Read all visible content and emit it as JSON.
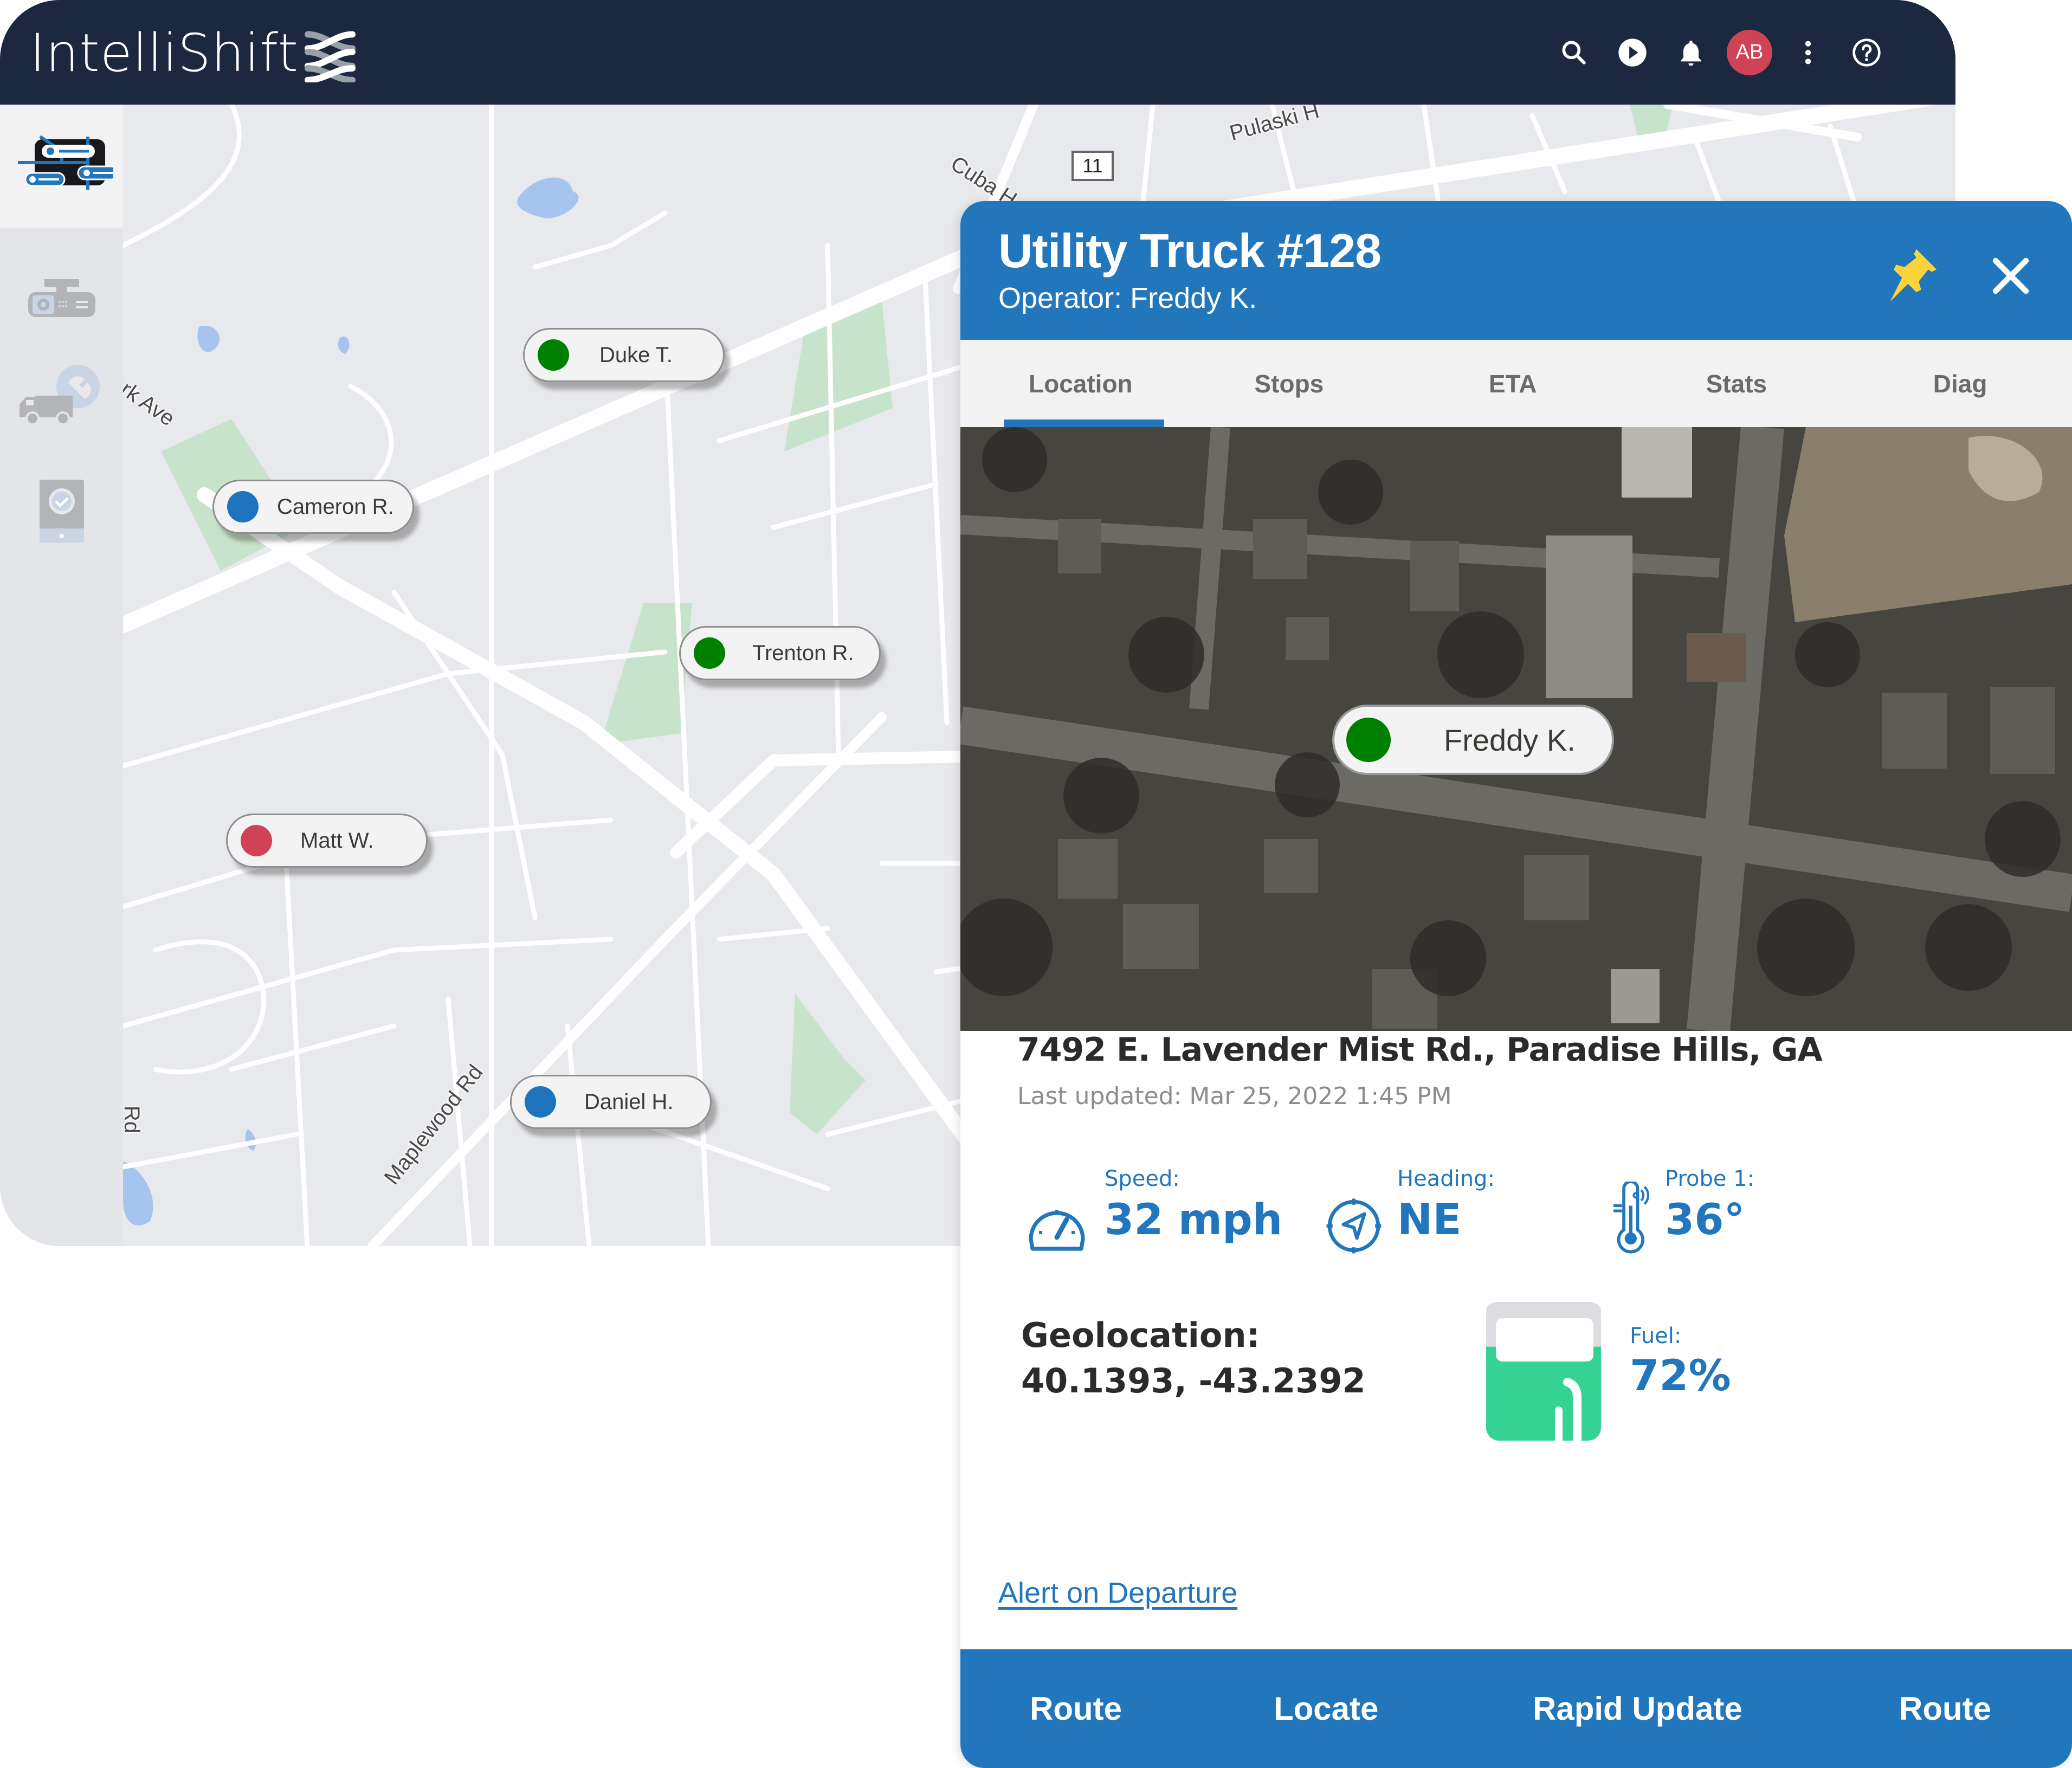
{
  "app": {
    "brand": "IntelliShift",
    "colors": {
      "header_bg": "#1c2740",
      "accent_blue": "#2176bc",
      "status_green": "#008000",
      "status_blue": "#1e73be",
      "status_red": "#d04356",
      "fuel_green": "#34d394"
    }
  },
  "header": {
    "actions": [
      {
        "icon": "search-icon",
        "label": "Search"
      },
      {
        "icon": "play-circle-icon",
        "label": "Play"
      },
      {
        "icon": "bell-icon",
        "label": "Notifications"
      },
      {
        "icon": "avatar",
        "label": "AB"
      },
      {
        "icon": "more-vertical-icon",
        "label": "More"
      },
      {
        "icon": "help-icon",
        "label": "Help"
      }
    ],
    "avatar_initials": "AB"
  },
  "sidebar": {
    "items": [
      {
        "icon": "live-map-icon",
        "label": "Live Map",
        "active": true
      },
      {
        "icon": "dashcam-icon",
        "label": "Dashcam",
        "active": false
      },
      {
        "icon": "truck-maintenance-icon",
        "label": "Maintenance",
        "active": false
      },
      {
        "icon": "mobile-inspection-icon",
        "label": "Inspections",
        "active": false
      }
    ]
  },
  "map": {
    "street_labels": [
      "Pulaski H",
      "Cuba H",
      "rk Ave",
      "Maplewood Rd",
      "Rd"
    ],
    "route_shield": "11",
    "markers": [
      {
        "name": "Duke T.",
        "status": "green"
      },
      {
        "name": "Cameron R.",
        "status": "blue"
      },
      {
        "name": "Trenton R.",
        "status": "green"
      },
      {
        "name": "Matt W.",
        "status": "red"
      },
      {
        "name": "Daniel H.",
        "status": "blue"
      }
    ]
  },
  "panel": {
    "title": "Utility Truck #128",
    "subtitle": "Operator: Freddy K.",
    "pin_icon": "pin-icon",
    "close_icon": "close-icon",
    "tabs": [
      {
        "label": "Location",
        "active": true
      },
      {
        "label": "Stops",
        "active": false
      },
      {
        "label": "ETA",
        "active": false
      },
      {
        "label": "Stats",
        "active": false
      },
      {
        "label": "Diag",
        "active": false
      }
    ],
    "satellite_marker": {
      "name": "Freddy K.",
      "status": "green"
    },
    "address": "7492 E. Lavender Mist Rd., Paradise Hills, GA",
    "last_updated": "Last updated: Mar 25, 2022 1:45 PM",
    "stats": {
      "speed": {
        "label": "Speed:",
        "value": "32 mph",
        "icon": "speedometer-icon"
      },
      "heading": {
        "label": "Heading:",
        "value": "NE",
        "icon": "compass-icon"
      },
      "probe": {
        "label": "Probe 1:",
        "value": "36°",
        "icon": "thermometer-icon"
      },
      "fuel": {
        "label": "Fuel:",
        "value": "72%",
        "percent": 72,
        "icon": "fuel-pump-icon"
      }
    },
    "geolocation": {
      "label": "Geolocation:",
      "value": "40.1393, -43.2392"
    },
    "alert_link": "Alert on Departure",
    "actions": [
      "Route",
      "Locate",
      "Rapid Update",
      "Route"
    ]
  }
}
